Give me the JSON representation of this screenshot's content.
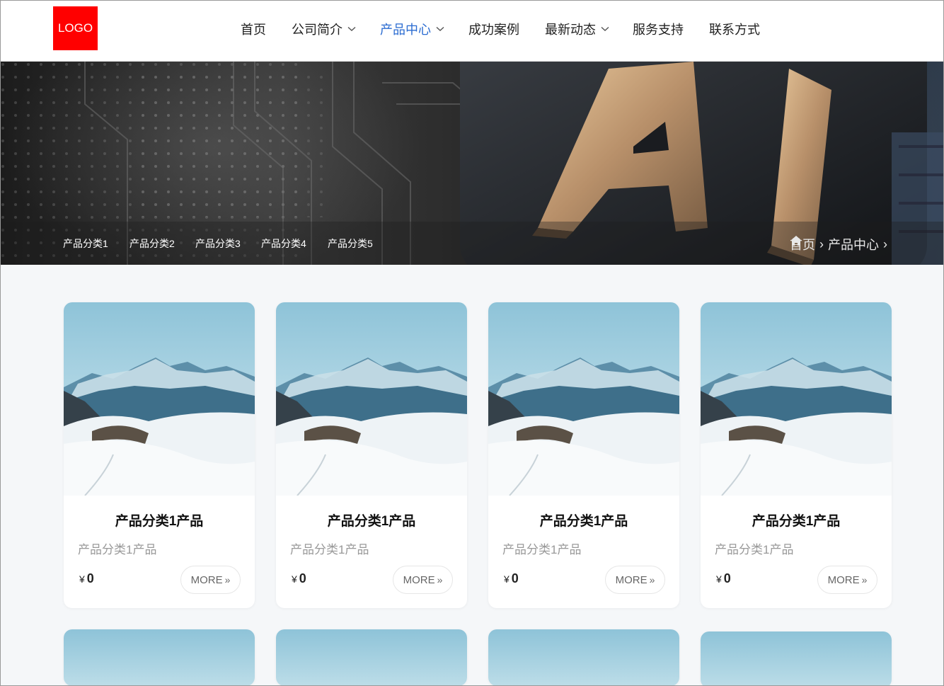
{
  "logo": {
    "text": "LOGO",
    "color": "#ff0000"
  },
  "nav": {
    "items": [
      {
        "label": "首页",
        "dropdown": false,
        "active": false
      },
      {
        "label": "公司简介",
        "dropdown": true,
        "active": false
      },
      {
        "label": "产品中心",
        "dropdown": true,
        "active": true
      },
      {
        "label": "成功案例",
        "dropdown": false,
        "active": false
      },
      {
        "label": "最新动态",
        "dropdown": true,
        "active": false
      },
      {
        "label": "服务支持",
        "dropdown": false,
        "active": false
      },
      {
        "label": "联系方式",
        "dropdown": false,
        "active": false
      }
    ],
    "active_color": "#2a6bd1"
  },
  "banner": {
    "categories": [
      "产品分类1",
      "产品分类2",
      "产品分类3",
      "产品分类4",
      "产品分类5"
    ],
    "breadcrumb": {
      "home": "首页",
      "separator": "›",
      "current": "产品中心",
      "icon": "home-icon"
    }
  },
  "products": [
    {
      "title": "产品分类1产品",
      "desc": "产品分类1产品",
      "currency": "¥",
      "price": "0",
      "more": "MORE",
      "more_icon": "double-chevron-right-icon"
    },
    {
      "title": "产品分类1产品",
      "desc": "产品分类1产品",
      "currency": "¥",
      "price": "0",
      "more": "MORE",
      "more_icon": "double-chevron-right-icon"
    },
    {
      "title": "产品分类1产品",
      "desc": "产品分类1产品",
      "currency": "¥",
      "price": "0",
      "more": "MORE",
      "more_icon": "double-chevron-right-icon"
    },
    {
      "title": "产品分类1产品",
      "desc": "产品分类1产品",
      "currency": "¥",
      "price": "0",
      "more": "MORE",
      "more_icon": "double-chevron-right-icon"
    }
  ]
}
